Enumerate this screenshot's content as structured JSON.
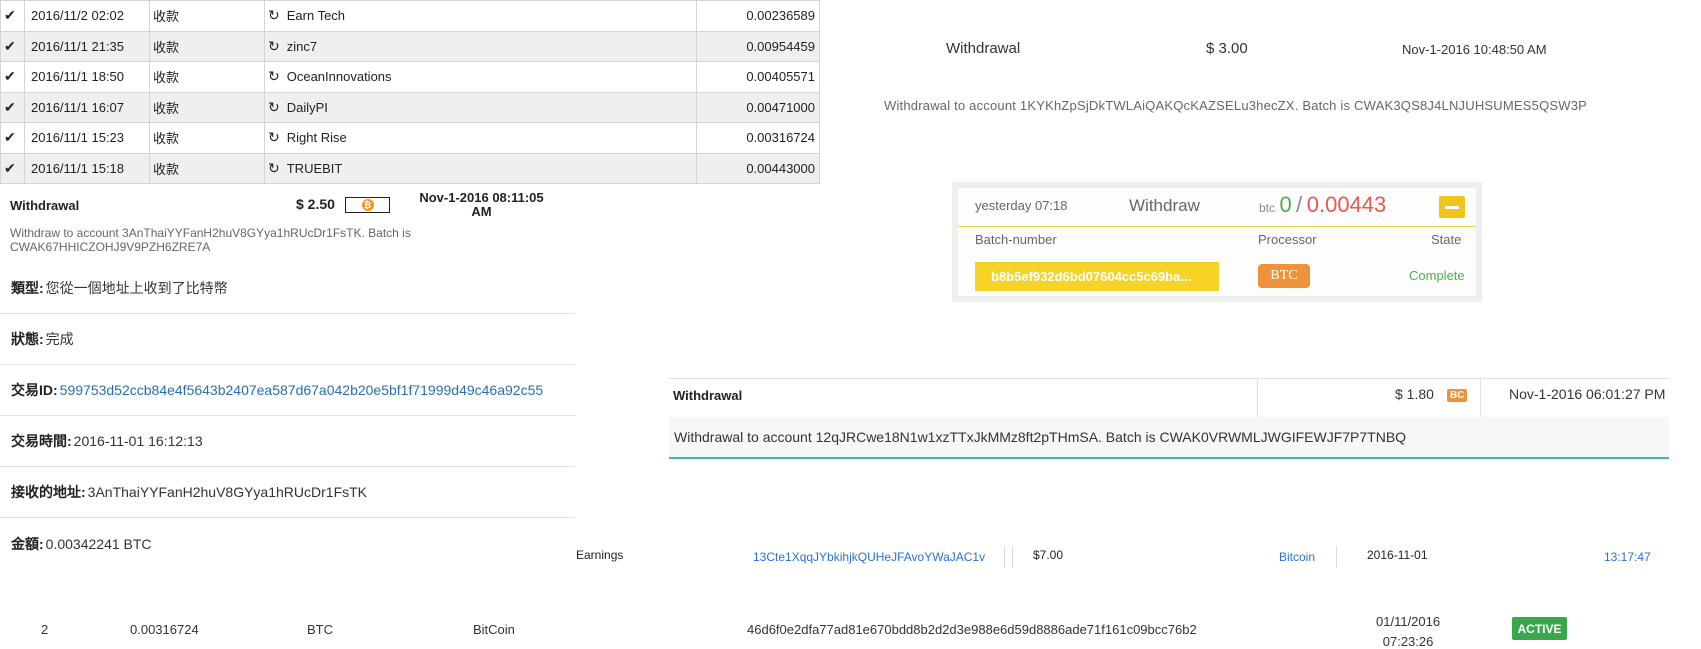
{
  "tx_table": {
    "rows": [
      {
        "date": "2016/11/2 02:02",
        "type": "收款",
        "name": "Earn Tech",
        "amount": "0.00236589"
      },
      {
        "date": "2016/11/1 21:35",
        "type": "收款",
        "name": "zinc7",
        "amount": "0.00954459"
      },
      {
        "date": "2016/11/1 18:50",
        "type": "收款",
        "name": "OceanInnovations",
        "amount": "0.00405571"
      },
      {
        "date": "2016/11/1 16:07",
        "type": "收款",
        "name": "DailyPI",
        "amount": "0.00471000"
      },
      {
        "date": "2016/11/1 15:23",
        "type": "收款",
        "name": "Right Rise",
        "amount": "0.00316724"
      },
      {
        "date": "2016/11/1 15:18",
        "type": "收款",
        "name": "TRUEBIT",
        "amount": "0.00443000"
      }
    ],
    "check_glyph": "✔",
    "refresh_glyph": "↻"
  },
  "withdrawal_a": {
    "title": "Withdrawal",
    "amount": "$ 3.00",
    "date": "Nov-1-2016 10:48:50 AM",
    "description": "Withdrawal to account 1KYKhZpSjDkTWLAiQAKQcKAZSELu3hecZX. Batch is CWAK3QS8J4LNJUHSUMES5QSW3P"
  },
  "withdrawal_b": {
    "title": "Withdrawal",
    "amount": "$ 2.50",
    "coin_symbol": "₿",
    "date_line1": "Nov-1-2016 08:11:05",
    "date_line2": "AM",
    "description_line1": "Withdraw to account 3AnThaiYYFanH2huV8GYya1hRUcDr1FsTK. Batch is",
    "description_line2": "CWAK67HHICZOHJ9V9PZH6ZRE7A"
  },
  "details": [
    {
      "label": "類型:",
      "value": "您從一個地址上收到了比特幣"
    },
    {
      "label": "狀態:",
      "value": "完成"
    },
    {
      "label": "交易ID:",
      "value": "599753d52ccb84e4f5643b2407ea587d67a042b20e5bf1f71999d49c46a92c55"
    },
    {
      "label": "交易時間:",
      "value": "2016-11-01 16:12:13"
    },
    {
      "label": "接收的地址:",
      "value": "3AnThaiYYFanH2huV8GYya1hRUcDr1FsTK"
    },
    {
      "label": "金額:",
      "value": "0.00342241 BTC"
    }
  ],
  "withdraw_card": {
    "time": "yesterday 07:18",
    "title": "Withdraw",
    "currency": "btc",
    "amount_zero": "0",
    "slash": "/",
    "amount": "0.00443",
    "headers": {
      "batch": "Batch-number",
      "processor": "Processor",
      "state": "State"
    },
    "batch": "b8b5ef932d6bd07604cc5c69ba...",
    "processor": "BTC",
    "state": "Complete",
    "colors": {
      "accent": "#f5d327",
      "green": "#4caf50",
      "red": "#e85a4a",
      "processor": "#f0923a"
    }
  },
  "withdrawal_c": {
    "title": "Withdrawal",
    "amount": "$ 1.80",
    "badge": "BC",
    "date": "Nov-1-2016 06:01:27 PM",
    "description": "Withdrawal to account 12qJRCwe18N1w1xzTTxJkMMz8ft2pTHmSA. Batch is CWAK0VRWMLJWGIFEWJF7P7TNBQ"
  },
  "earnings_row": {
    "type": "Earnings",
    "address": "13Cte1XqqJYbkihjkQUHeJFAvoYWaJAC1v",
    "amount": "$7.00",
    "method": "Bitcoin",
    "date": "2016-11-01",
    "time": "13:17:47"
  },
  "payout_row": {
    "number": "2",
    "amount": "0.00316724",
    "currency": "BTC",
    "method": "BitCoin",
    "hash": "46d6f0e2dfa77ad81e670bdd8b2d2d3e988e6d59d8886ade71f161c09bcc76b2",
    "date": "01/11/2016",
    "time": "07:23:26",
    "status": "ACTIVE"
  }
}
